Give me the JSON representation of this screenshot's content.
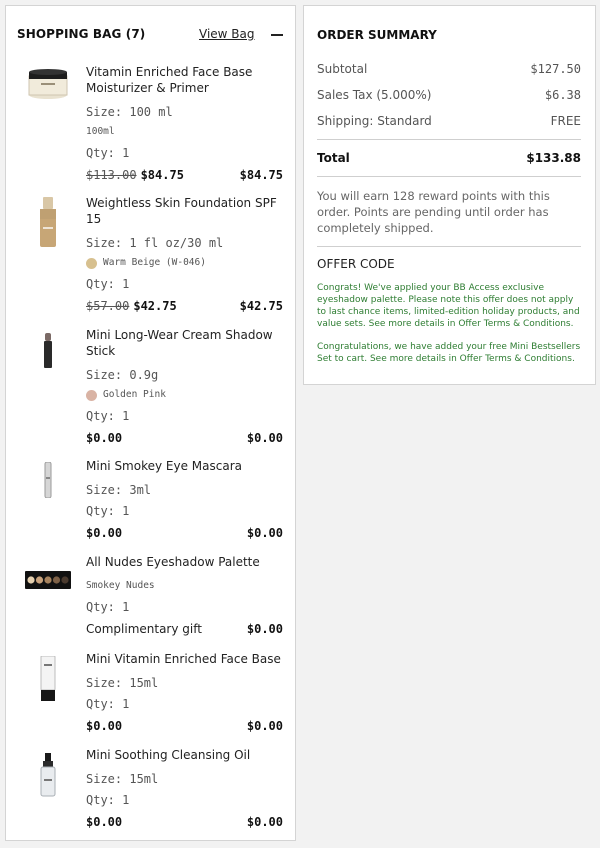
{
  "bag": {
    "title": "SHOPPING BAG (7)",
    "view_bag_label": "View Bag",
    "items": [
      {
        "name": "Vitamin Enriched Face Base Moisturizer & Primer",
        "size": "Size: 100 ml",
        "extra": "100ml",
        "qty": "Qty: 1",
        "orig_price": "$113.00",
        "price": "$84.75",
        "total": "$84.75"
      },
      {
        "name": "Weightless Skin Foundation SPF 15",
        "size": "Size: 1 fl oz/30 ml",
        "shade": "Warm Beige (W-046)",
        "shade_color": "#d7c08f",
        "qty": "Qty: 1",
        "orig_price": "$57.00",
        "price": "$42.75",
        "total": "$42.75"
      },
      {
        "name": "Mini Long-Wear Cream Shadow Stick",
        "size": "Size: 0.9g",
        "shade": "Golden Pink",
        "shade_color": "#d9b3a4",
        "qty": "Qty: 1",
        "price": "$0.00",
        "total": "$0.00"
      },
      {
        "name": "Mini Smokey Eye Mascara",
        "size": "Size: 3ml",
        "qty": "Qty: 1",
        "price": "$0.00",
        "total": "$0.00"
      },
      {
        "name": "All Nudes Eyeshadow Palette",
        "extra": "Smokey Nudes",
        "qty": "Qty: 1",
        "price": "Complimentary gift",
        "total": "$0.00"
      },
      {
        "name": "Mini Vitamin Enriched Face Base",
        "size": "Size: 15ml",
        "qty": "Qty: 1",
        "price": "$0.00",
        "total": "$0.00"
      },
      {
        "name": "Mini Soothing Cleansing Oil",
        "size": "Size: 15ml",
        "qty": "Qty: 1",
        "price": "$0.00",
        "total": "$0.00"
      }
    ]
  },
  "summary": {
    "title": "ORDER SUMMARY",
    "subtotal_label": "Subtotal",
    "subtotal_value": "$127.50",
    "tax_label": "Sales Tax (5.000%)",
    "tax_value": "$6.38",
    "shipping_label": "Shipping: Standard",
    "shipping_value": "FREE",
    "total_label": "Total",
    "total_value": "$133.88",
    "reward_text": "You will earn 128 reward points with this order. Points are pending until order has completely shipped.",
    "offer_title": "OFFER CODE",
    "offer_msg_1": "Congrats! We've applied your BB Access exclusive eyeshadow palette. Please note this offer does not apply to last chance items, limited-edition holiday products, and value sets. See more details in Offer Terms & Conditions.",
    "offer_msg_2": "Congratulations, we have added your free Mini Bestsellers Set to cart. See more details in Offer Terms & Conditions.",
    "offer_color": "#2e7d32"
  }
}
